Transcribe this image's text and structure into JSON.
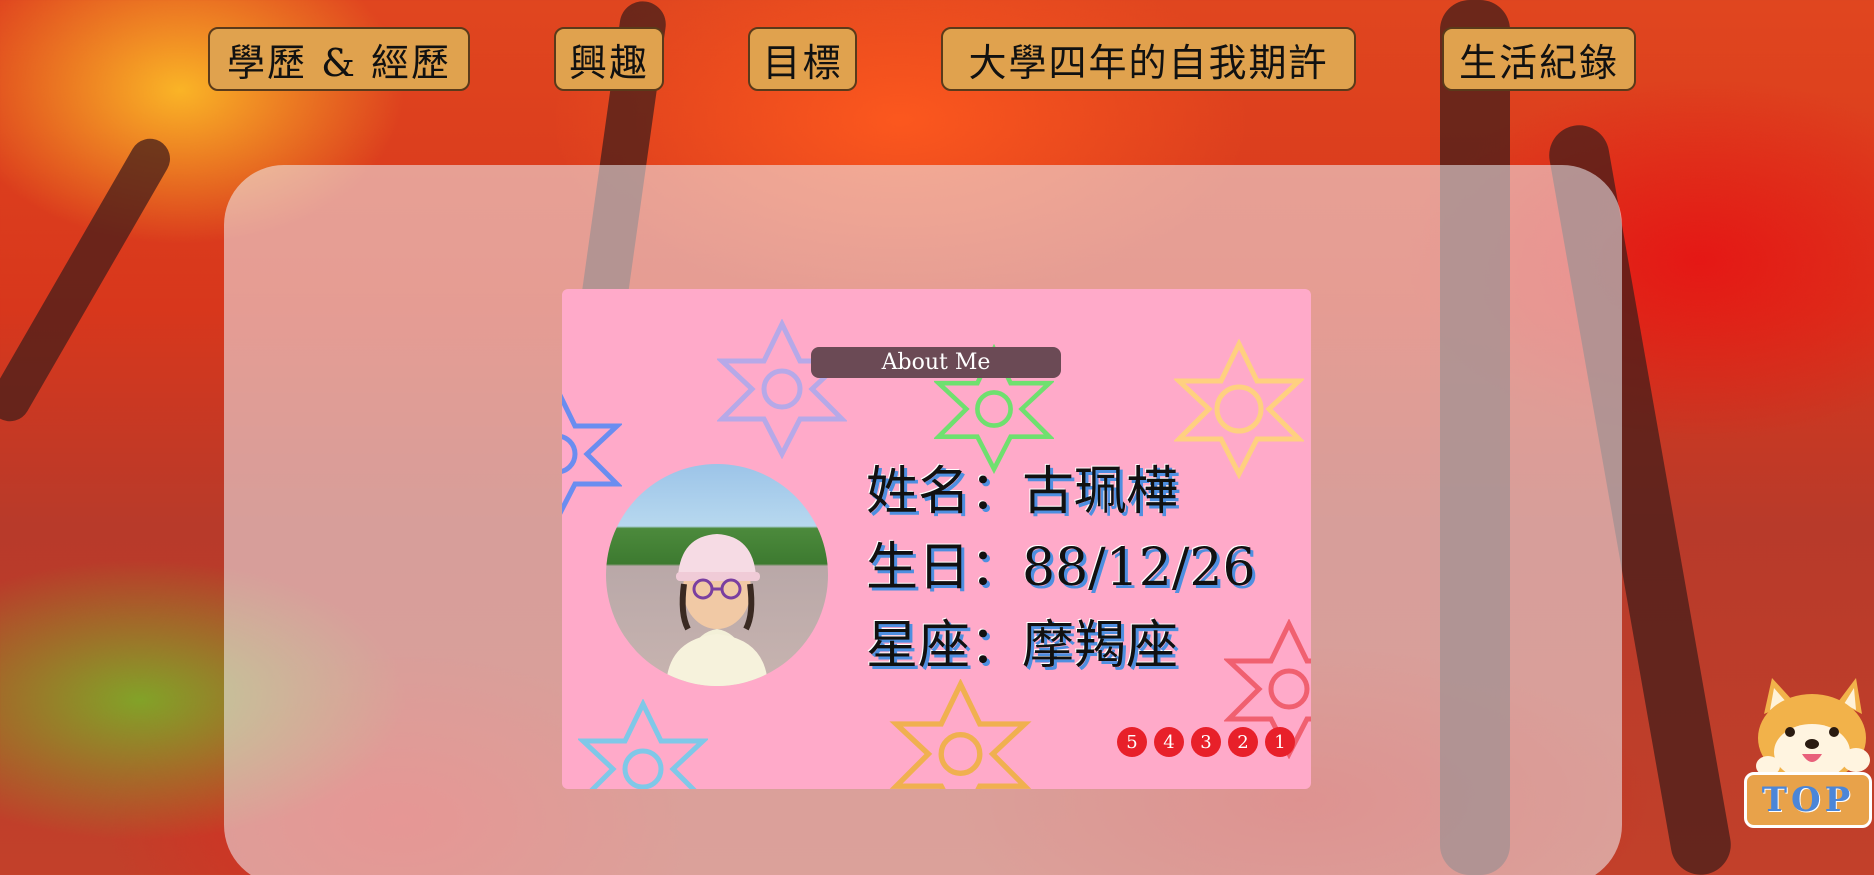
{
  "nav": {
    "items": [
      {
        "label": "學歷 & 經歷"
      },
      {
        "label": "興趣"
      },
      {
        "label": "目標"
      },
      {
        "label": "大學四年的自我期許"
      },
      {
        "label": "生活紀錄"
      }
    ]
  },
  "card": {
    "tag": "About Me",
    "name_line": "姓名：古珮樺",
    "birthday_line": "生日：88/12/26",
    "zodiac_line": "星座：摩羯座",
    "slides": [
      "5",
      "4",
      "3",
      "2",
      "1"
    ]
  },
  "top_button": {
    "label": "TOP"
  },
  "colors": {
    "nav_button": "#e0a24e",
    "card_bg": "#ffaac9",
    "slide_dot": "#e8202a",
    "text_shadow": "#4e8fe0"
  }
}
